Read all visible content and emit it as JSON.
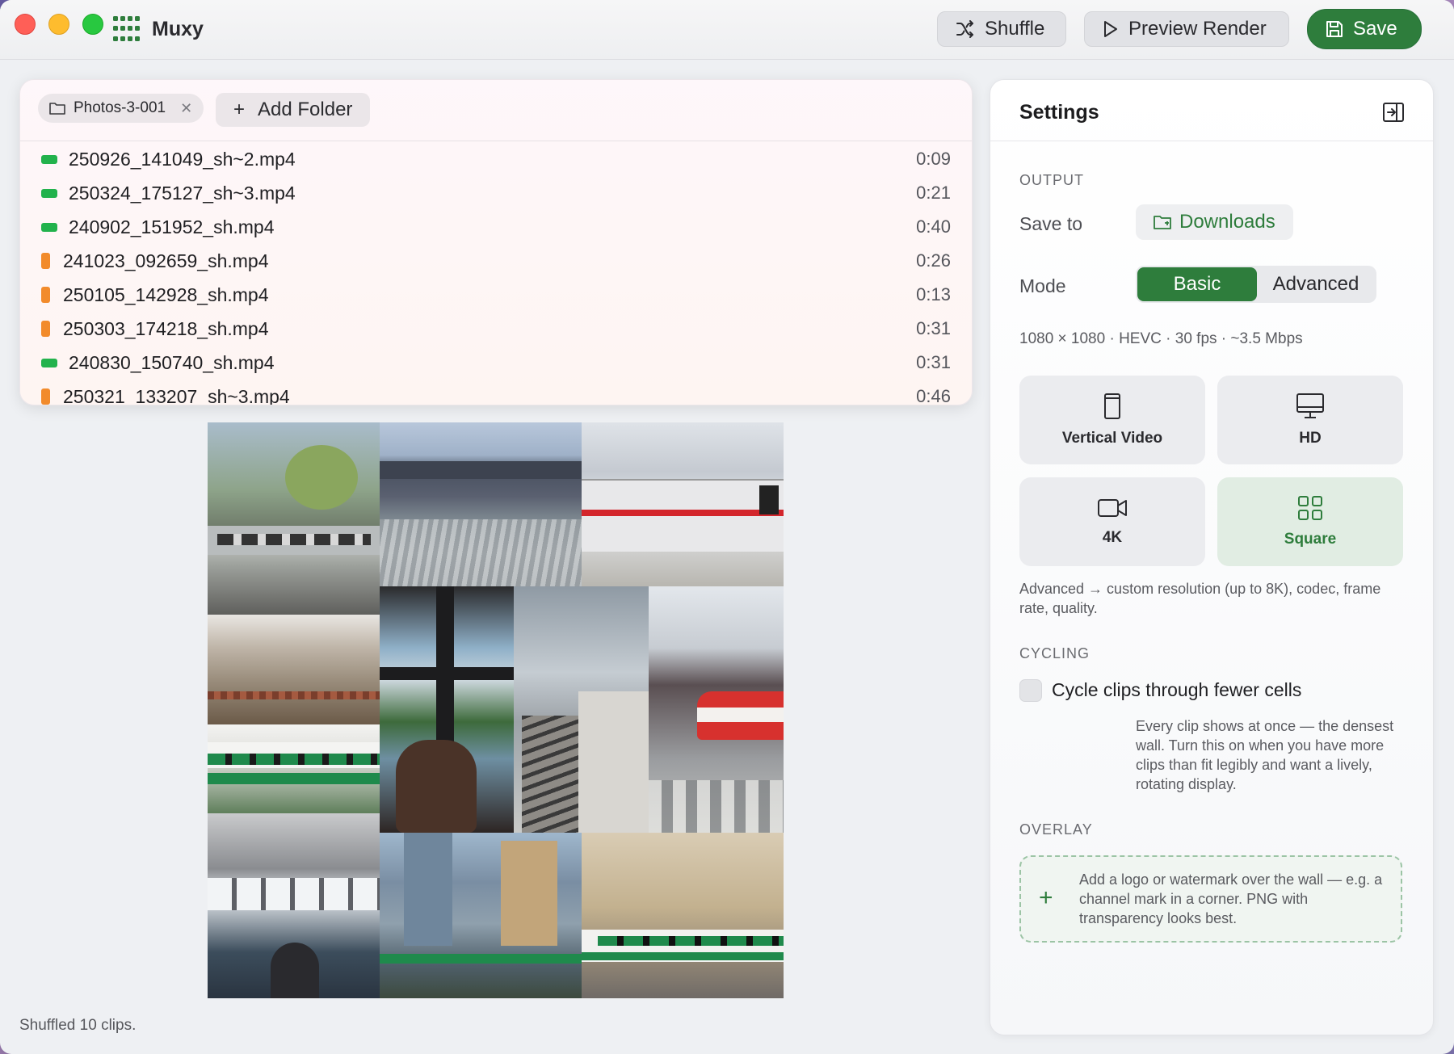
{
  "app": {
    "title": "Muxy"
  },
  "toolbar": {
    "shuffle_label": "Shuffle",
    "preview_label": "Preview Render",
    "save_label": "Save"
  },
  "files": {
    "folder_chip": "Photos-3-001",
    "add_folder_label": "Add Folder",
    "items": [
      {
        "name": "250926_141049_sh~2.mp4",
        "duration": "0:09",
        "orientation": "landscape",
        "color": "#22b24c"
      },
      {
        "name": "250324_175127_sh~3.mp4",
        "duration": "0:21",
        "orientation": "landscape",
        "color": "#22b24c"
      },
      {
        "name": "240902_151952_sh.mp4",
        "duration": "0:40",
        "orientation": "landscape",
        "color": "#22b24c"
      },
      {
        "name": "241023_092659_sh.mp4",
        "duration": "0:26",
        "orientation": "portrait",
        "color": "#f28b2b"
      },
      {
        "name": "250105_142928_sh.mp4",
        "duration": "0:13",
        "orientation": "portrait",
        "color": "#f28b2b"
      },
      {
        "name": "250303_174218_sh.mp4",
        "duration": "0:31",
        "orientation": "portrait",
        "color": "#f28b2b"
      },
      {
        "name": "240830_150740_sh.mp4",
        "duration": "0:31",
        "orientation": "landscape",
        "color": "#22b24c"
      },
      {
        "name": "250321_133207_sh~3.mp4",
        "duration": "0:46",
        "orientation": "portrait",
        "color": "#f28b2b"
      }
    ]
  },
  "status": "Shuffled 10 clips.",
  "settings": {
    "title": "Settings",
    "output_label": "OUTPUT",
    "save_to_label": "Save to",
    "save_to_value": "Downloads",
    "mode_label": "Mode",
    "mode_options": [
      "Basic",
      "Advanced"
    ],
    "mode_selected": "Basic",
    "spec_line": "1080 × 1080 · HEVC · 30 fps · ~3.5 Mbps",
    "presets": [
      {
        "label": "Vertical Video",
        "icon": "phone-icon"
      },
      {
        "label": "HD",
        "icon": "monitor-icon"
      },
      {
        "label": "4K",
        "icon": "video-camera-icon"
      },
      {
        "label": "Square",
        "icon": "grid-icon",
        "selected": true
      }
    ],
    "advanced_note": "Advanced → custom resolution (up to 8K), codec, frame rate, quality.",
    "cycling_label": "CYCLING",
    "cycle_checkbox_label": "Cycle clips through fewer cells",
    "cycle_checked": false,
    "cycle_note": "Every clip shows at once — the densest wall. Turn this on when you have more clips than fit legibly and want a lively, rotating display.",
    "overlay_label": "OVERLAY",
    "overlay_note": "Add a logo or watermark over the wall — e.g. a channel mark in a corner. PNG with transparency looks best."
  },
  "colors": {
    "accent": "#2e7d3c",
    "accent_soft": "#e1ede3"
  }
}
